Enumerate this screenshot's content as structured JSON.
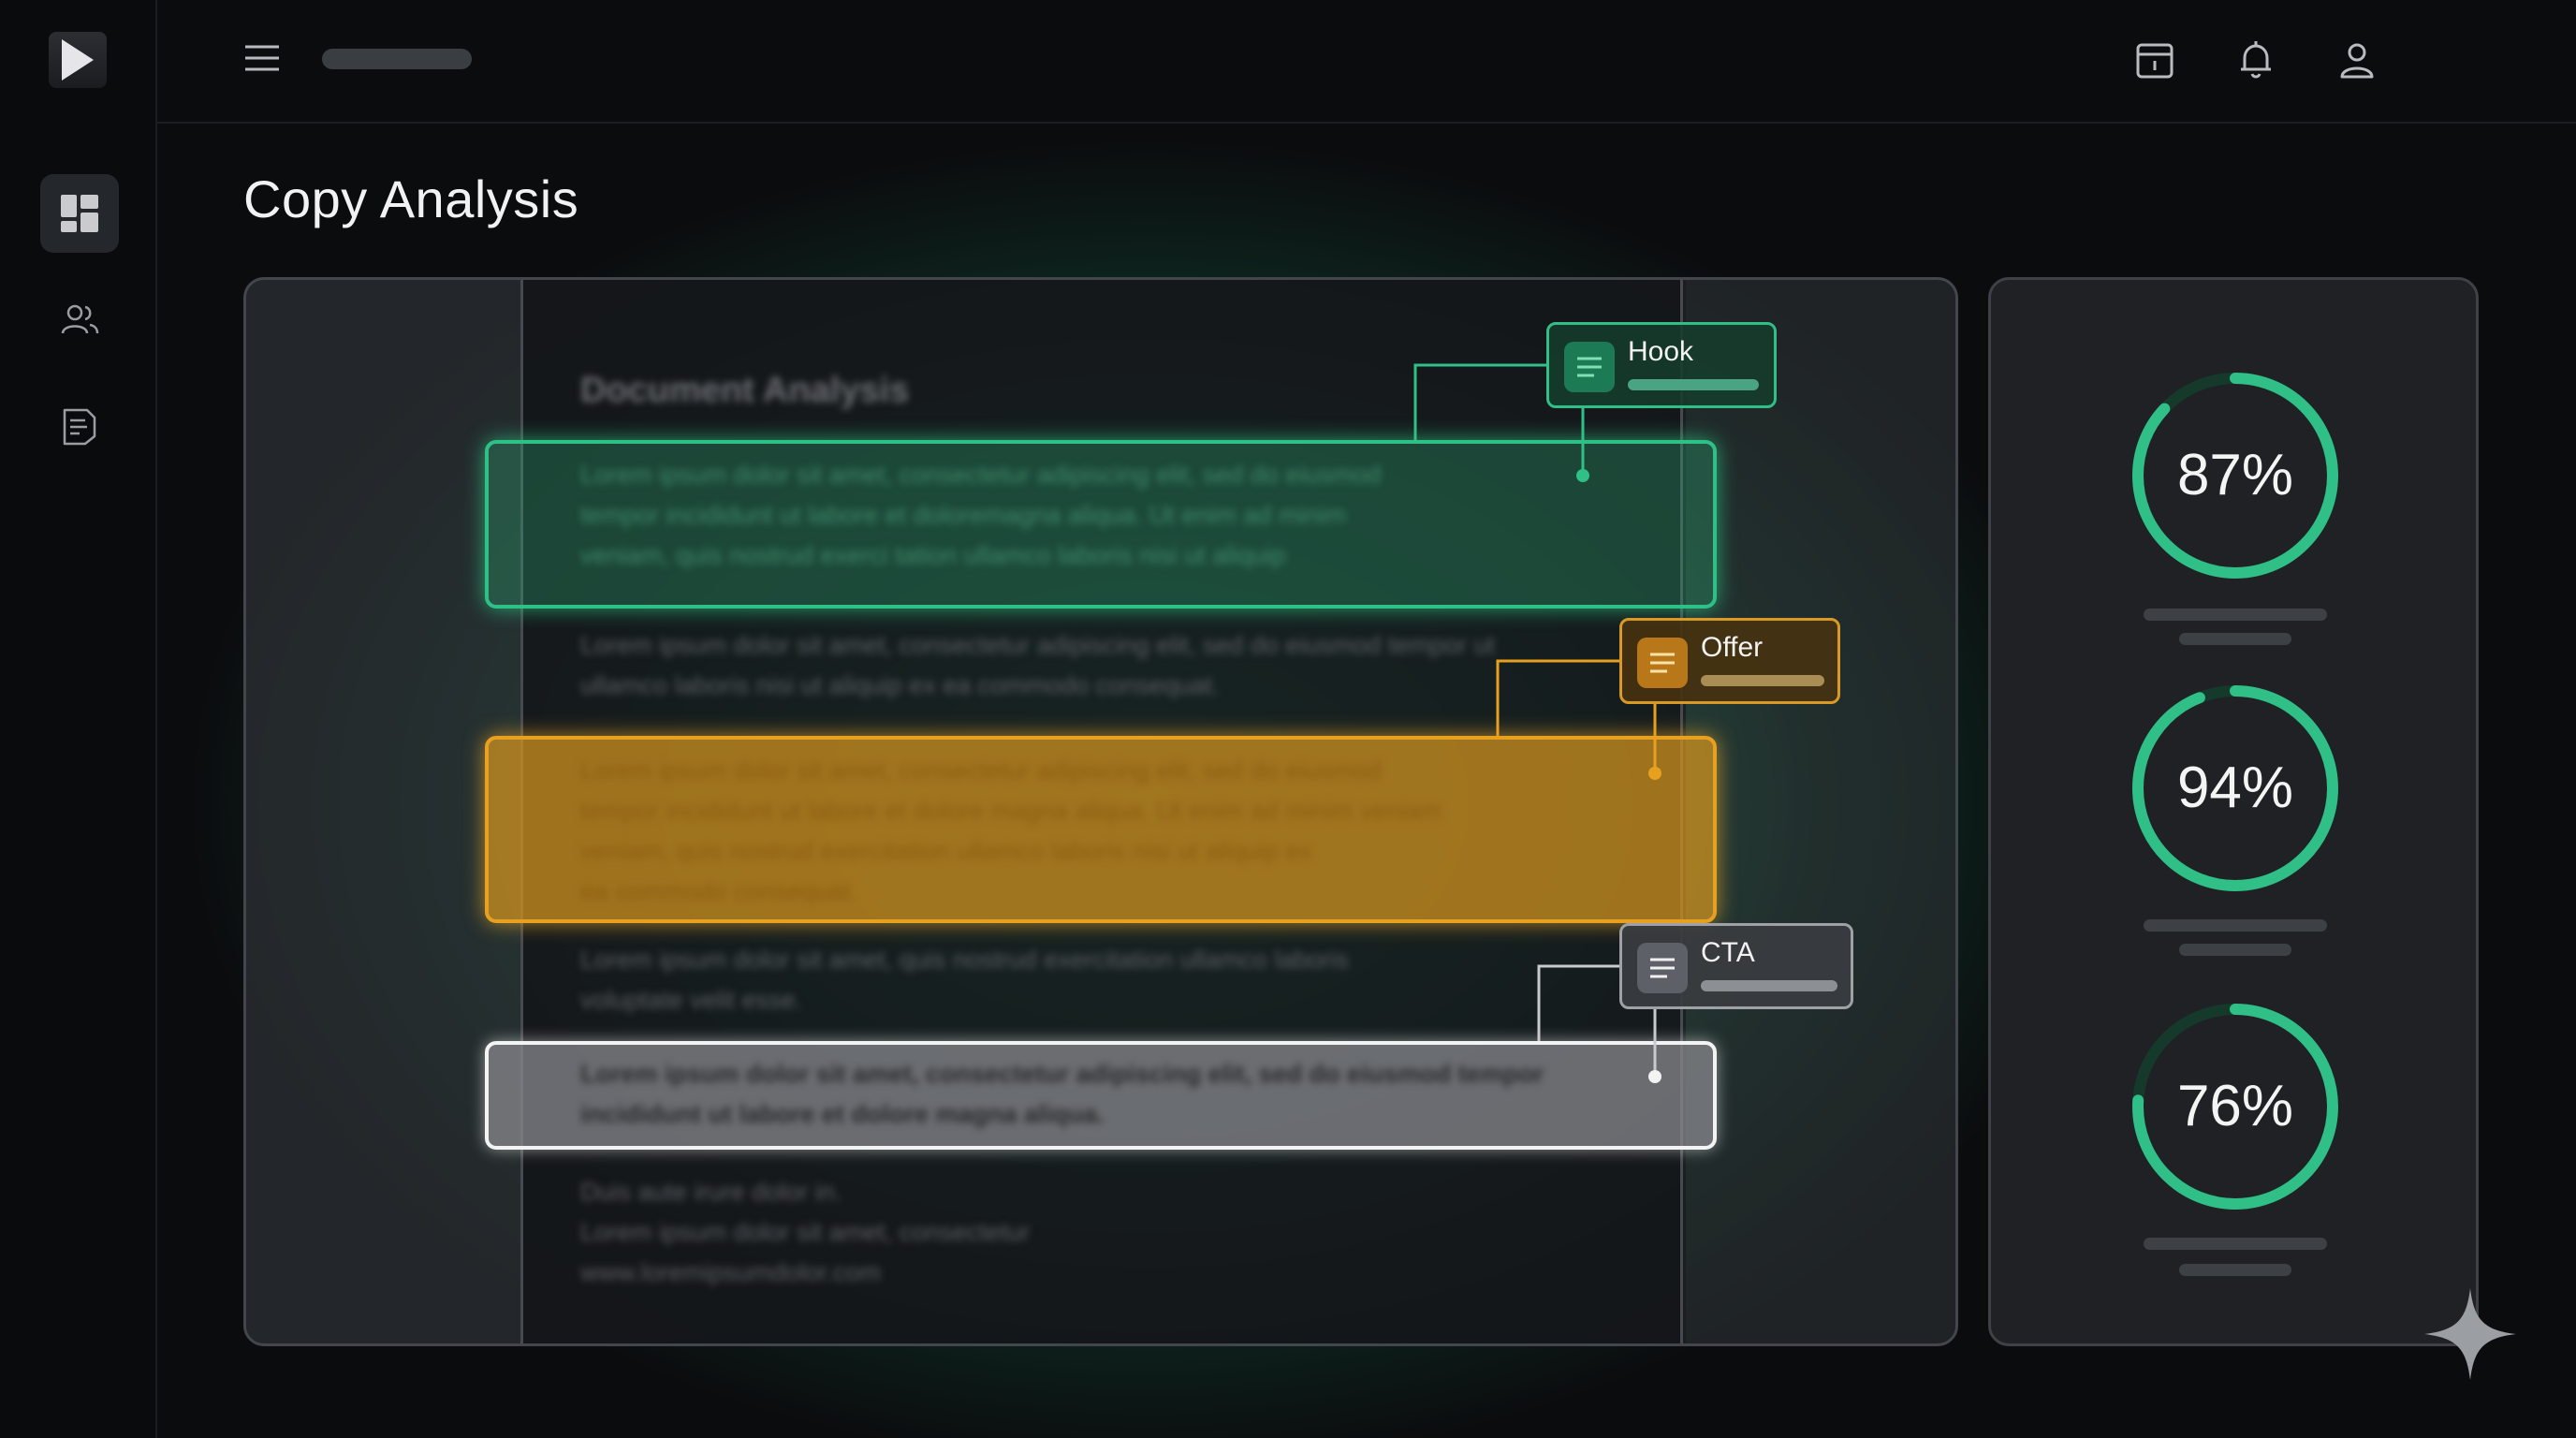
{
  "header": {
    "page_title": "Copy Analysis",
    "icons": [
      "menu-icon",
      "calendar-icon",
      "bell-icon",
      "user-icon"
    ]
  },
  "sidebar": {
    "items": [
      {
        "icon": "dashboard-icon",
        "active": true
      },
      {
        "icon": "users-icon",
        "active": false
      },
      {
        "icon": "document-icon",
        "active": false
      }
    ]
  },
  "document": {
    "heading": "Document Analysis",
    "paragraphs": [
      [
        "Lorem ipsum dolor sit amet, consectetur adipiscing elit, sed do eiusmod",
        "tempor incididunt ut labore et doloremagna aliqua. Ut enim ad minim",
        "veniam, quis nostrud exerci tation ullamco laboris nisi ut aliquip"
      ],
      [
        "Lorem ipsum dolor sit amet, consectetur adipiscing elit, sed do eiusmod tempor ut",
        "ullamco laboris nisi ut aliquip ex ea commodo consequat."
      ],
      [
        "Lorem ipsum dolor sit amet, consectetur adipiscing elit, sed do eiusmod",
        "tempor incididunt ut labore et dolore magna aliqua. Ut enim ad minim veniam",
        "veniam, quis nostrud exercitation ullamco laboris nisi ut aliquip ex",
        "ea commodo consequat."
      ],
      [
        "Lorem ipsum dolor sit amet, quis nostrud exercitation ullamco laboris",
        "voluptate velit esse."
      ],
      [
        "Lorem ipsum dolor sit amet, consectetur adipiscing elit, sed do eiusmod tempor",
        "incididunt ut labore et dolore magna aliqua."
      ],
      [
        "Duis aute irure dolor in.",
        "Lorem ipsum dolor sit amet, consectetur",
        "www.loremipsumdolor.com"
      ]
    ]
  },
  "tags": {
    "hook": "Hook",
    "offer": "Offer",
    "cta": "CTA"
  },
  "scores": [
    {
      "value": "87%",
      "fraction": 0.87
    },
    {
      "value": "94%",
      "fraction": 0.94
    },
    {
      "value": "76%",
      "fraction": 0.76
    }
  ],
  "colors": {
    "accent_green": "#2fbf87",
    "accent_orange": "#e8a020",
    "cta_white": "#f3f3f3",
    "background": "#0b0c0e"
  }
}
